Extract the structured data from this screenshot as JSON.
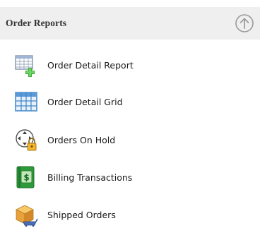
{
  "panel": {
    "title": "Order Reports",
    "collapse_icon": "circle-arrow-up-icon"
  },
  "items": [
    {
      "label": "Order Detail Report",
      "icon": "report-add-icon"
    },
    {
      "label": "Order Detail Grid",
      "icon": "grid-icon"
    },
    {
      "label": "Orders On Hold",
      "icon": "hold-lock-icon"
    },
    {
      "label": "Billing Transactions",
      "icon": "money-icon"
    },
    {
      "label": "Shipped Orders",
      "icon": "shipping-cart-icon"
    }
  ],
  "colors": {
    "header_bg": "#efefef",
    "grid_blue": "#3f86c8",
    "money_green": "#2e9b3a",
    "box_orange": "#e9a13b"
  }
}
